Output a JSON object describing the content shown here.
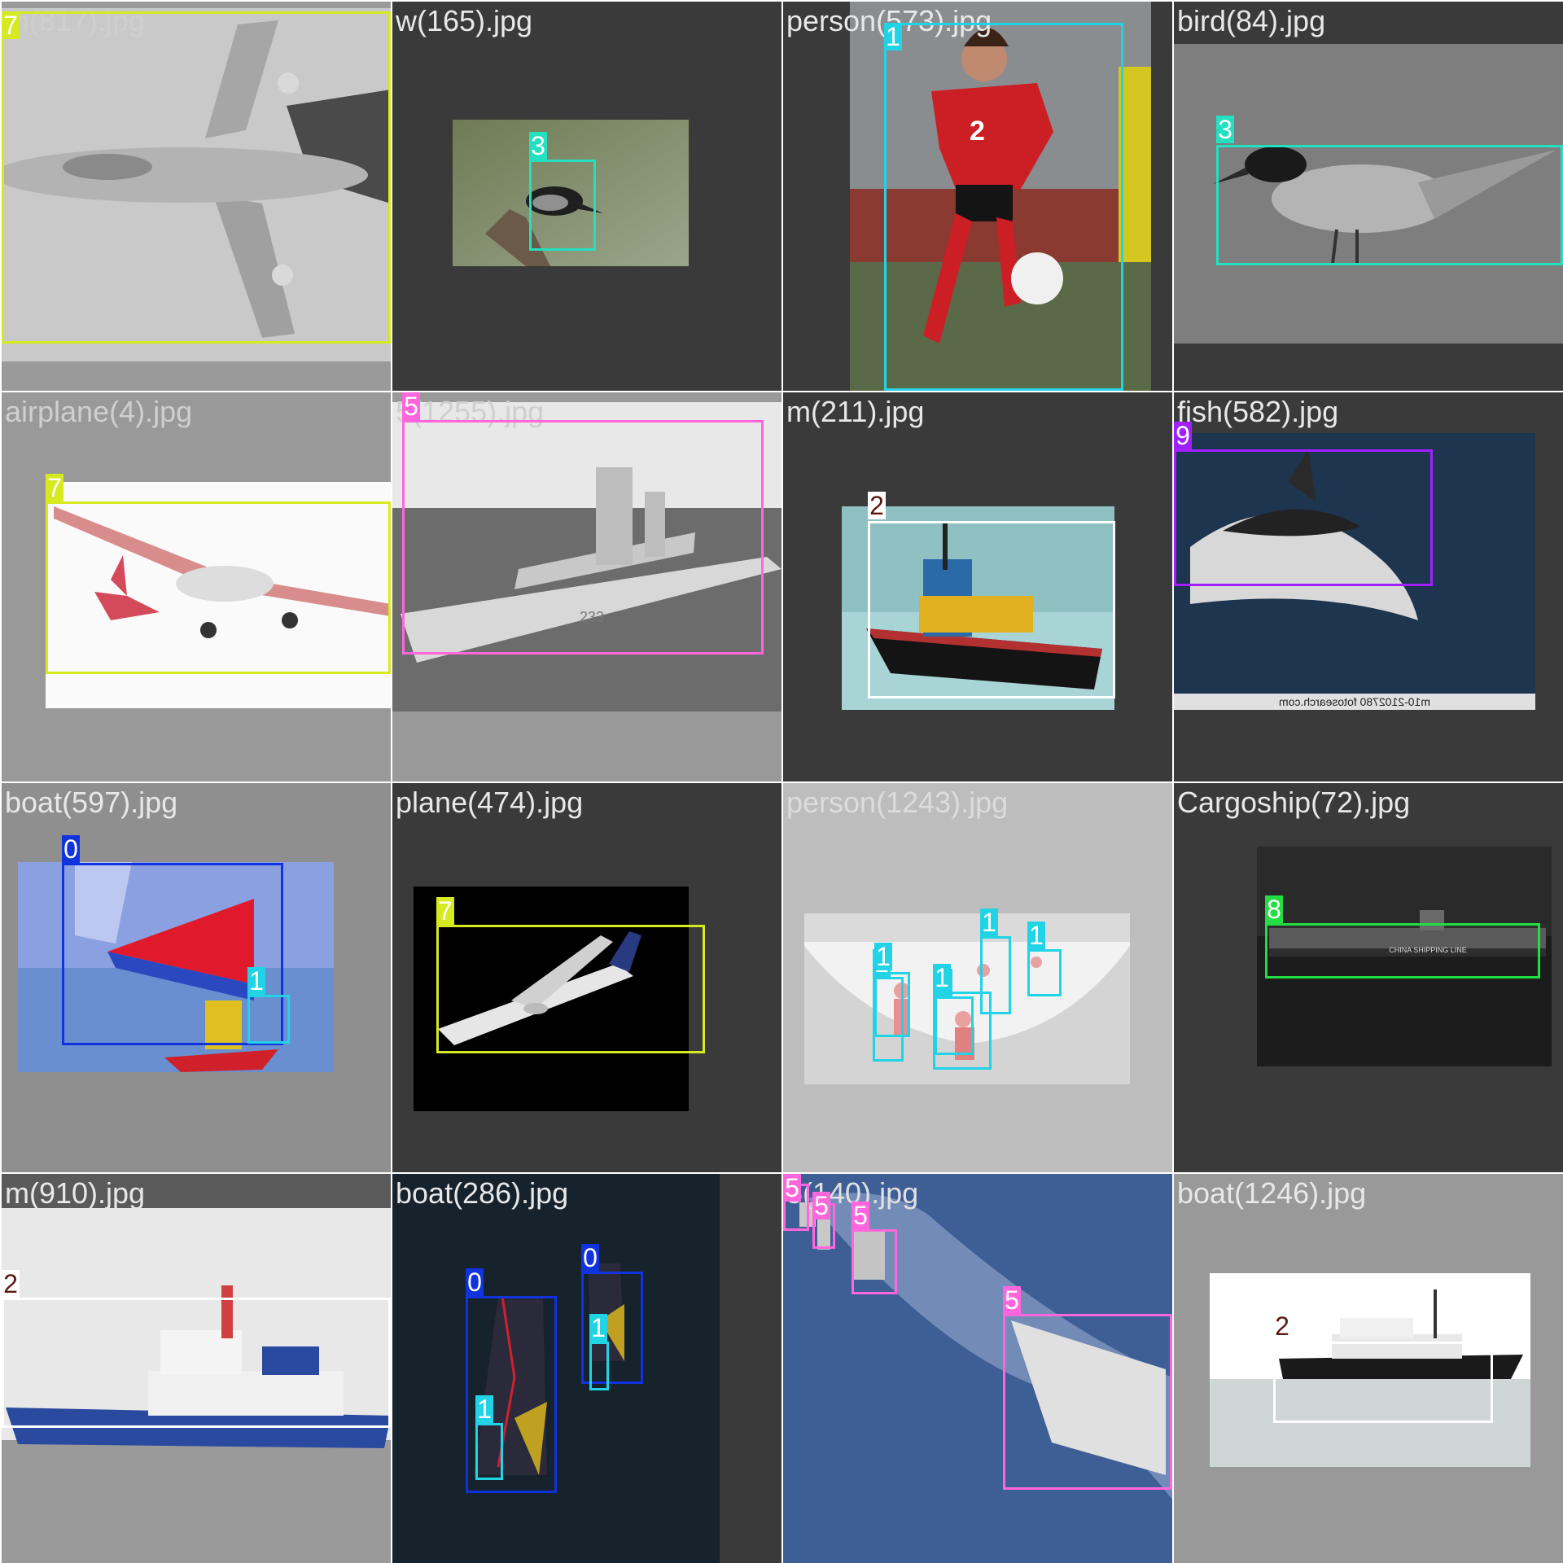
{
  "colors": {
    "class_0": "#1133dd",
    "class_1": "#22d3e6",
    "class_2": "#ffffff",
    "class_3": "#22e0c0",
    "class_5": "#ff66dd",
    "class_7": "#d6ea22",
    "class_8": "#22dd44",
    "class_9": "#a020ff"
  },
  "tiles": [
    {
      "filename": "m(817).jpg",
      "bg": "#9a9a9a",
      "label_color": "#cfcfcf",
      "photo": "jet",
      "boxes": [
        {
          "cls": "7",
          "color": "#d6ea22",
          "tag_text_color": "#ffffff"
        }
      ]
    },
    {
      "filename": "w(165).jpg",
      "bg": "#3a3a3a",
      "label_color": "#e8e8e8",
      "photo": "bird-branch",
      "boxes": [
        {
          "cls": "3",
          "color": "#22e0c0",
          "tag_text_color": "#ffffff"
        }
      ]
    },
    {
      "filename": "person(573).jpg",
      "bg": "#3a3a3a",
      "label_color": "#e8e8e8",
      "photo": "soccer",
      "boxes": [
        {
          "cls": "1",
          "color": "#22d3e6",
          "tag_text_color": "#ffffff"
        }
      ]
    },
    {
      "filename": "bird(84).jpg",
      "bg": "#3a3a3a",
      "label_color": "#e8e8e8",
      "photo": "tern",
      "boxes": [
        {
          "cls": "3",
          "color": "#22e0c0",
          "tag_text_color": "#ffffff"
        }
      ]
    },
    {
      "filename": "airplane(4).jpg",
      "bg": "#999999",
      "label_color": "#cfcfcf",
      "photo": "propplane",
      "boxes": [
        {
          "cls": "7",
          "color": "#d6ea22",
          "tag_text_color": "#ffffff"
        }
      ]
    },
    {
      "filename": "5(1255).jpg",
      "bg": "#999999",
      "label_color": "#cfcfcf",
      "photo": "warship",
      "boxes": [
        {
          "cls": "5",
          "color": "#ff66dd",
          "tag_text_color": "#ffffff"
        }
      ]
    },
    {
      "filename": "m(211).jpg",
      "bg": "#3a3a3a",
      "label_color": "#e8e8e8",
      "photo": "tug",
      "boxes": [
        {
          "cls": "2",
          "color": "#ffffff",
          "tag_text_color": "#5a1a10"
        }
      ]
    },
    {
      "filename": "fish(582).jpg",
      "bg": "#3a3a3a",
      "label_color": "#e8e8e8",
      "photo": "dolphin",
      "watermark": "m10-2102780 fotosearch.com",
      "boxes": [
        {
          "cls": "9",
          "color": "#a020ff",
          "tag_text_color": "#ffffff"
        }
      ]
    },
    {
      "filename": "boat(597).jpg",
      "bg": "#8f8f8f",
      "label_color": "#e8e8e8",
      "photo": "sailboat",
      "boxes": [
        {
          "cls": "0",
          "color": "#1133dd",
          "tag_text_color": "#ffffff"
        },
        {
          "cls": "1",
          "color": "#22d3e6",
          "tag_text_color": "#ffffff"
        }
      ]
    },
    {
      "filename": "plane(474).jpg",
      "bg": "#3a3a3a",
      "label_color": "#e8e8e8",
      "photo": "airliner",
      "boxes": [
        {
          "cls": "7",
          "color": "#d6ea22",
          "tag_text_color": "#ffffff"
        }
      ]
    },
    {
      "filename": "person(1243).jpg",
      "bg": "#bdbdbd",
      "label_color": "#dcdcdc",
      "photo": "skatepark",
      "boxes": [
        {
          "cls": "1",
          "color": "#22d3e6",
          "tag_text_color": "#ffffff"
        },
        {
          "cls": "1",
          "color": "#22d3e6",
          "tag_text_color": "#ffffff"
        },
        {
          "cls": "1",
          "color": "#22d3e6",
          "tag_text_color": "#ffffff"
        },
        {
          "cls": "1",
          "color": "#22d3e6",
          "tag_text_color": "#ffffff"
        },
        {
          "cls": "1",
          "color": "#22d3e6",
          "tag_text_color": "#ffffff"
        },
        {
          "cls": "1",
          "color": "#22d3e6",
          "tag_text_color": "#ffffff"
        }
      ]
    },
    {
      "filename": "Cargoship(72).jpg",
      "bg": "#3a3a3a",
      "label_color": "#e8e8e8",
      "photo": "cargo",
      "ship_text": "CHINA SHIPPING LINE",
      "boxes": [
        {
          "cls": "8",
          "color": "#22dd44",
          "tag_text_color": "#ffffff"
        }
      ]
    },
    {
      "filename": "m(910).jpg",
      "bg": "#5a5a5a",
      "label_color": "#e8e8e8",
      "photo": "tug2",
      "boxes": [
        {
          "cls": "2",
          "color": "#ffffff",
          "tag_text_color": "#5a1a10"
        }
      ]
    },
    {
      "filename": "boat(286).jpg",
      "bg": "#3a3a3a",
      "label_color": "#e8e8e8",
      "photo": "windsurf",
      "boxes": [
        {
          "cls": "0",
          "color": "#1133dd",
          "tag_text_color": "#ffffff"
        },
        {
          "cls": "1",
          "color": "#22d3e6",
          "tag_text_color": "#ffffff"
        },
        {
          "cls": "0",
          "color": "#1133dd",
          "tag_text_color": "#ffffff"
        },
        {
          "cls": "1",
          "color": "#22d3e6",
          "tag_text_color": "#ffffff"
        }
      ]
    },
    {
      "filename": "5(140).jpg",
      "bg": "#4a6a9a",
      "label_color": "#e0e0e0",
      "photo": "fleet",
      "boxes": [
        {
          "cls": "5",
          "color": "#ff66dd",
          "tag_text_color": "#ffffff"
        },
        {
          "cls": "5",
          "color": "#ff66dd",
          "tag_text_color": "#ffffff"
        },
        {
          "cls": "5",
          "color": "#ff66dd",
          "tag_text_color": "#ffffff"
        },
        {
          "cls": "5",
          "color": "#ff66dd",
          "tag_text_color": "#ffffff"
        }
      ]
    },
    {
      "filename": "boat(1246).jpg",
      "bg": "#999999",
      "label_color": "#e8e8e8",
      "photo": "yacht",
      "boxes": [
        {
          "cls": "2",
          "color": "#ffffff",
          "tag_text_color": "#5a1a10"
        }
      ]
    }
  ]
}
